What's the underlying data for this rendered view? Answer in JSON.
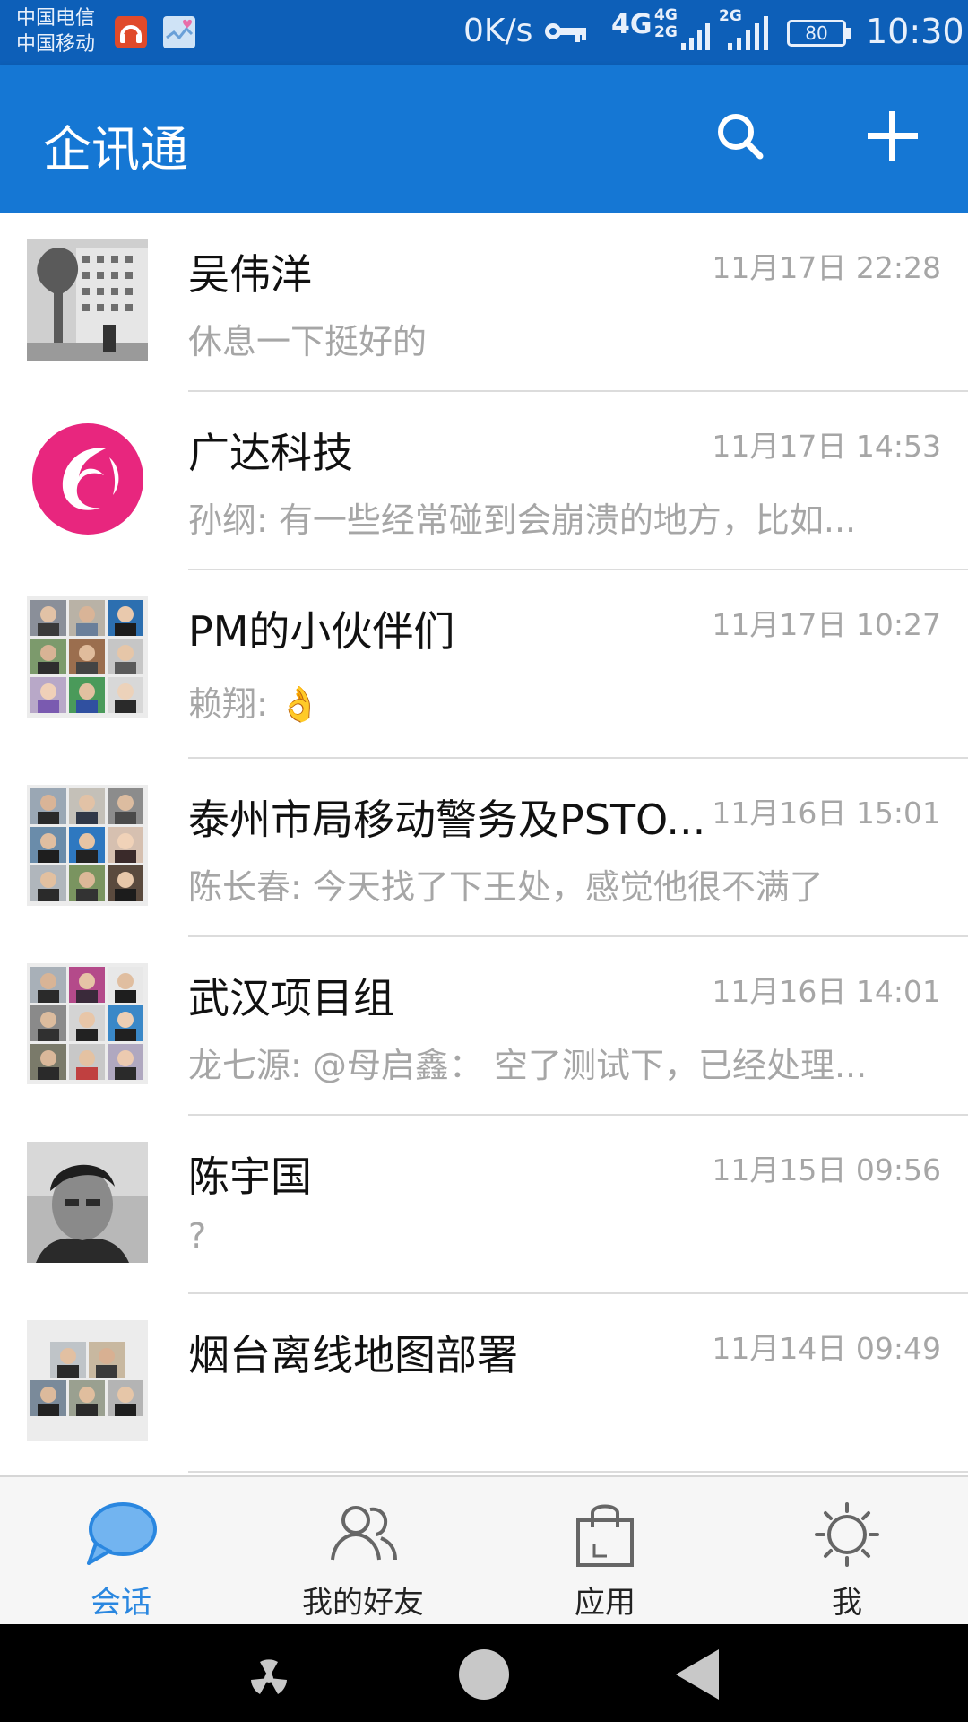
{
  "status_bar": {
    "carrier_1": "中国电信",
    "carrier_2": "中国移动",
    "speed": "0K/s",
    "net_4g": "4G",
    "net_4g_2g": "4G\n2G",
    "net_2g": "2G",
    "battery": "80",
    "time": "10:30"
  },
  "app_bar": {
    "title": "企讯通",
    "search_icon": "search-icon",
    "add_icon": "plus-icon"
  },
  "conversations": [
    {
      "name": "吴伟洋",
      "time": "11月17日 22:28",
      "preview": "休息一下挺好的",
      "avatar": "photo-building"
    },
    {
      "name": "广达科技",
      "time": "11月17日 14:53",
      "preview": "孙纲: 有一些经常碰到会崩溃的地方，比如...",
      "avatar": "logo-pink"
    },
    {
      "name": "PM的小伙伴们",
      "time": "11月17日 10:27",
      "preview": "赖翔: 👌",
      "avatar": "group-grid"
    },
    {
      "name": "泰州市局移动警务及PSTO...",
      "time": "11月16日 15:01",
      "preview": "陈长春: 今天找了下王处，感觉他很不满了",
      "avatar": "group-grid"
    },
    {
      "name": "武汉项目组",
      "time": "11月16日 14:01",
      "preview": "龙七源: @母启鑫： 空了测试下，已经处理...",
      "avatar": "group-grid"
    },
    {
      "name": "陈宇国",
      "time": "11月15日 09:56",
      "preview": "?",
      "avatar": "photo-person"
    },
    {
      "name": "烟台离线地图部署",
      "time": "11月14日 09:49",
      "preview": "",
      "avatar": "group-grid-5"
    }
  ],
  "tabs": [
    {
      "label": "会话",
      "icon": "chat-bubble-icon",
      "active": true
    },
    {
      "label": "我的好友",
      "icon": "friends-icon",
      "active": false
    },
    {
      "label": "应用",
      "icon": "shopping-bag-icon",
      "active": false
    },
    {
      "label": "我",
      "icon": "sun-gear-icon",
      "active": false
    }
  ],
  "colors": {
    "status_bar": "#0d5fb8",
    "app_bar": "#1577d4",
    "active_tab": "#2a87e0",
    "secondary_text": "#a6a6a6"
  }
}
